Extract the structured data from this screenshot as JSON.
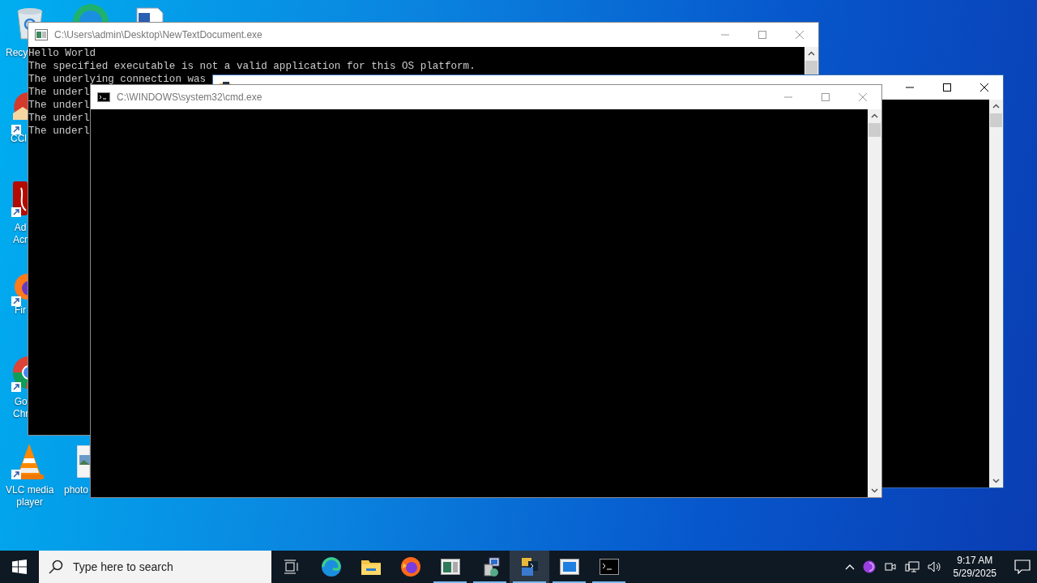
{
  "desktop_icons": [
    {
      "kind": "bin",
      "label_lines": [
        "Recy"
      ]
    },
    {
      "kind": "browser"
    },
    {
      "kind": "document"
    },
    {
      "kind": "cleaner",
      "label_lines": [
        "CCl"
      ]
    },
    {
      "kind": "reader",
      "label_lines": [
        "Ad",
        "Acr"
      ]
    },
    {
      "kind": "fox",
      "label_lines": [
        "Fir"
      ]
    },
    {
      "kind": "chrome",
      "label_lines": [
        "Go",
        "Chr"
      ]
    },
    {
      "kind": "cone",
      "label_lines": [
        "VLC media",
        "player"
      ]
    },
    {
      "kind": "image",
      "label_lines": [
        "photo"
      ]
    }
  ],
  "windows": [
    {
      "title": "C:\\Users\\admin\\Desktop\\NewTextDocument.exe",
      "focused": false,
      "lines": [
        "Hello World",
        "The specified executable is not a valid application for this OS platform.",
        "The underlying connection was",
        "The underl",
        "The underl",
        "The underl",
        "The underl"
      ]
    },
    {
      "focused": true
    },
    {
      "title": "C:\\WINDOWS\\system32\\cmd.exe",
      "focused": false
    }
  ],
  "taskbar": {
    "search": {
      "placeholder": "Type here to search"
    },
    "apps": [
      {
        "running": false,
        "selected": false
      },
      {
        "running": false,
        "selected": false
      },
      {
        "running": false,
        "selected": false
      },
      {
        "running": false,
        "selected": false
      },
      {
        "running": true,
        "selected": false
      },
      {
        "running": true,
        "selected": false
      },
      {
        "running": true,
        "selected": true
      },
      {
        "running": true,
        "selected": false
      },
      {
        "running": true,
        "selected": false
      }
    ],
    "clock": {
      "time": "9:17 AM",
      "date": "5/29/2025"
    }
  }
}
